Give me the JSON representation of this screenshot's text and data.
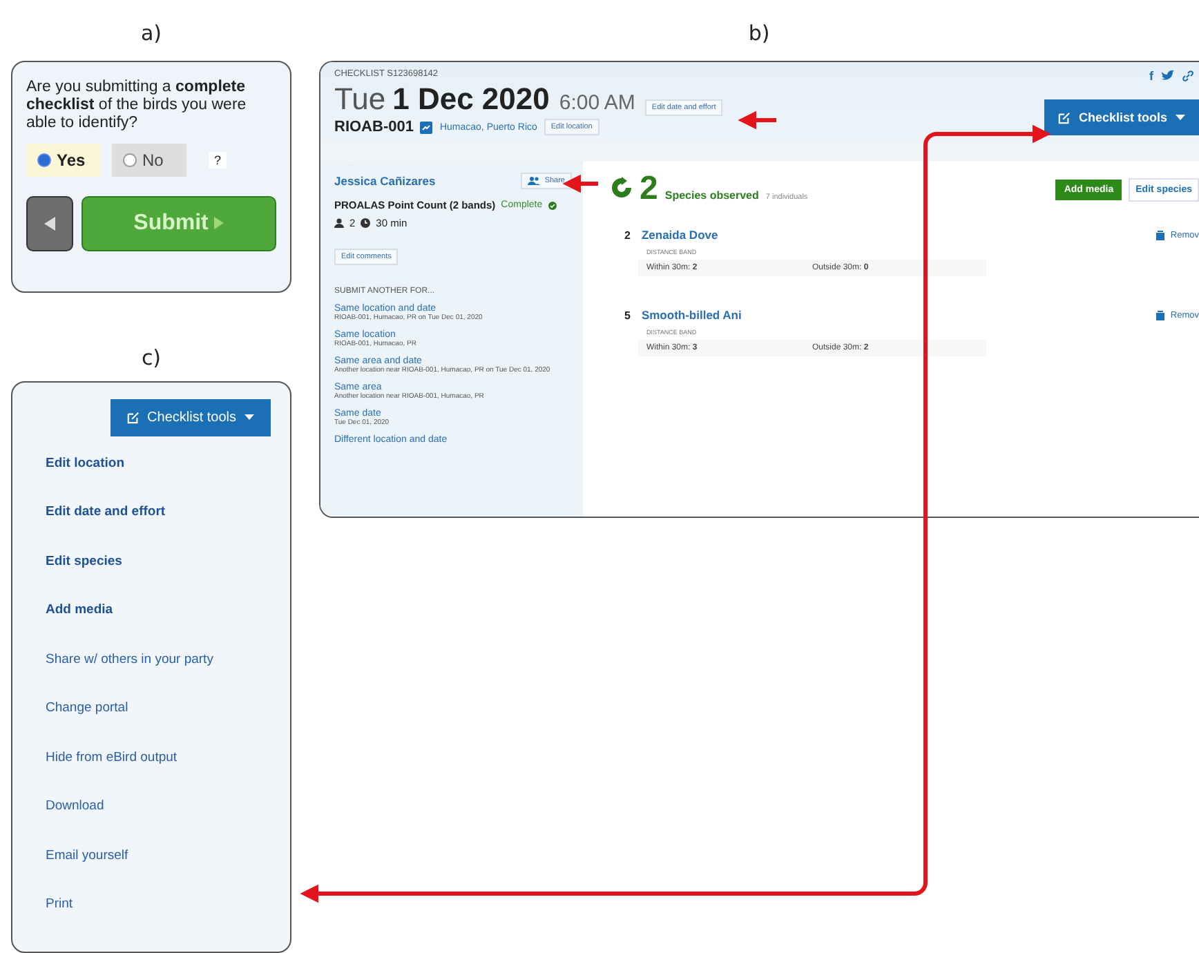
{
  "panel_a": {
    "label": "a)",
    "question": "Are you submitting a **complete checklist** of the birds you were able to identify?",
    "options": [
      {
        "label": "Yes",
        "selected": true
      },
      {
        "label": "No",
        "selected": false
      }
    ],
    "help": "?",
    "submit": "Submit"
  },
  "panel_b": {
    "label": "b)",
    "checklist_id": "CHECKLIST S123698142",
    "weekday": "Tue",
    "date": "1 Dec 2020",
    "time": "6:00 AM",
    "edit_date": "Edit date and effort",
    "location_code": "RIOAB-001",
    "location_name": "Humacao, Puerto Rico",
    "edit_location": "Edit location",
    "facebook": "f",
    "checklist_tools": "Checklist tools",
    "observer": "Jessica Cañizares",
    "share": "Share",
    "protocol": "PROALAS Point Count (2 bands)",
    "status": "Complete",
    "party_size": "2",
    "duration": "30 min",
    "edit_comments": "Edit comments",
    "submit_another": {
      "heading": "SUBMIT ANOTHER FOR...",
      "links": [
        {
          "title": "Same location and date",
          "detail": "RIOAB-001, Humacao, PR on Tue Dec 01, 2020"
        },
        {
          "title": "Same location",
          "detail": "RIOAB-001, Humacao, PR"
        },
        {
          "title": "Same area and date",
          "detail": "Another location near RIOAB-001, Humacao, PR on Tue Dec 01, 2020"
        },
        {
          "title": "Same area",
          "detail": "Another location near RIOAB-001, Humacao, PR"
        },
        {
          "title": "Same date",
          "detail": "Tue Dec 01, 2020"
        },
        {
          "title": "Different location and date"
        }
      ]
    },
    "species_count": "2",
    "species_label": "Species observed",
    "individuals": "7 individuals",
    "add_media": "Add media",
    "edit_species": "Edit species",
    "species": [
      {
        "count": "2",
        "name": "Zenaida Dove",
        "band_label": "DISTANCE BAND",
        "within_label": "Within 30m:",
        "within": "2",
        "outside_label": "Outside 30m:",
        "outside": "0",
        "remove": "Remov"
      },
      {
        "count": "5",
        "name": "Smooth-billed Ani",
        "band_label": "DISTANCE BAND",
        "within_label": "Within 30m:",
        "within": "3",
        "outside_label": "Outside 30m:",
        "outside": "2",
        "remove": "Remov"
      }
    ]
  },
  "panel_c": {
    "label": "c)",
    "button": "Checklist tools",
    "menu": [
      {
        "label": "Edit location",
        "bold": true
      },
      {
        "label": "Edit date and effort",
        "bold": true
      },
      {
        "label": "Edit species",
        "bold": true
      },
      {
        "label": "Add media",
        "bold": true
      },
      {
        "label": "Share w/ others in your party",
        "bold": false
      },
      {
        "label": "Change portal",
        "bold": false
      },
      {
        "label": "Hide from eBird output",
        "bold": false
      },
      {
        "label": "Download",
        "bold": false
      },
      {
        "label": "Email yourself",
        "bold": false
      },
      {
        "label": "Print",
        "bold": false
      }
    ]
  }
}
